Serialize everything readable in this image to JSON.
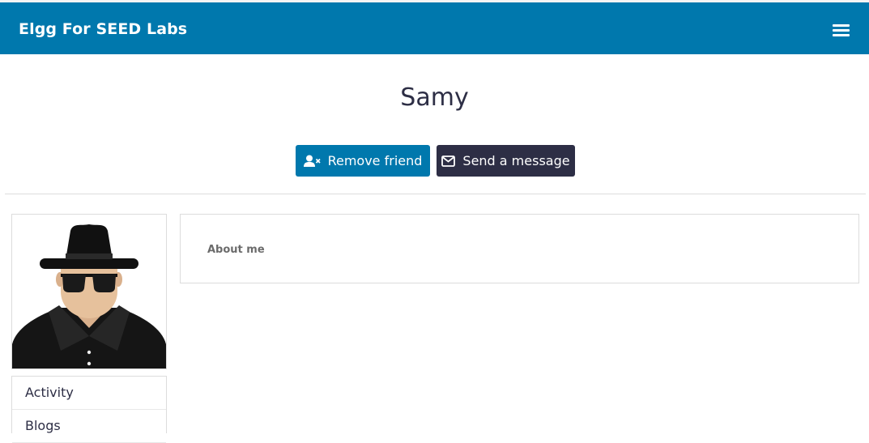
{
  "header": {
    "site_title": "Elgg For SEED Labs",
    "menu_icon": "hamburger-menu-icon",
    "bg_color": "#0078ad"
  },
  "profile": {
    "name": "Samy",
    "avatar_icon": "spy-avatar-image"
  },
  "actions": {
    "remove_friend": {
      "label": "Remove friend",
      "icon": "user-remove-icon",
      "color": "#0078ad"
    },
    "send_message": {
      "label": "Send a message",
      "icon": "envelope-icon",
      "color": "#2d2e45"
    }
  },
  "sidebar": {
    "items": [
      {
        "label": "Activity"
      },
      {
        "label": "Blogs"
      }
    ]
  },
  "main": {
    "about_label": "About me"
  }
}
